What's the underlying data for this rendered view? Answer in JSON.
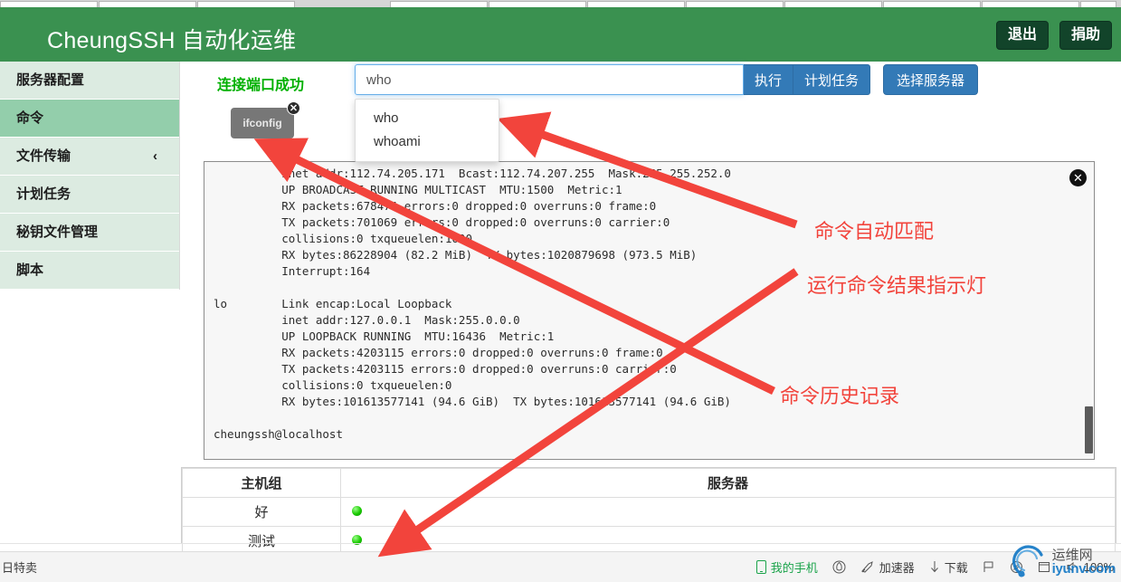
{
  "browser": {
    "tabs_visible": 12
  },
  "header": {
    "brand": "CheungSSH 自动化运维",
    "logout_label": "退出",
    "donate_label": "捐助",
    "bg_color": "#3a9150"
  },
  "sidebar": {
    "items": [
      {
        "label": "服务器配置",
        "active": false,
        "chevron": ""
      },
      {
        "label": "命令",
        "active": true,
        "chevron": ""
      },
      {
        "label": "文件传输",
        "active": false,
        "chevron": "‹"
      },
      {
        "label": "计划任务",
        "active": false,
        "chevron": ""
      },
      {
        "label": "秘钥文件管理",
        "active": false,
        "chevron": ""
      },
      {
        "label": "脚本",
        "active": false,
        "chevron": ""
      }
    ]
  },
  "toolbar": {
    "connection_status": "连接端口成功",
    "connection_status_color": "#00b000",
    "command_value": "who",
    "command_placeholder": "",
    "execute_label": "执行",
    "schedule_label": "计划任务",
    "select_server_label": "选择服务器"
  },
  "autocomplete": {
    "items": [
      "who",
      "whoami"
    ]
  },
  "history": {
    "tags": [
      {
        "label": "ifconfig",
        "close": "✕"
      }
    ]
  },
  "terminal": {
    "close_icon": "✕",
    "output": "          inet addr:112.74.205.171  Bcast:112.74.207.255  Mask:255.255.252.0\n          UP BROADCAST RUNNING MULTICAST  MTU:1500  Metric:1\n          RX packets:678474 errors:0 dropped:0 overruns:0 frame:0\n          TX packets:701069 errors:0 dropped:0 overruns:0 carrier:0\n          collisions:0 txqueuelen:1000\n          RX bytes:86228904 (82.2 MiB)  TX bytes:1020879698 (973.5 MiB)\n          Interrupt:164\n\nlo        Link encap:Local Loopback\n          inet addr:127.0.0.1  Mask:255.0.0.0\n          UP LOOPBACK RUNNING  MTU:16436  Metric:1\n          RX packets:4203115 errors:0 dropped:0 overruns:0 frame:0\n          TX packets:4203115 errors:0 dropped:0 overruns:0 carrier:0\n          collisions:0 txqueuelen:0\n          RX bytes:101613577141 (94.6 GiB)  TX bytes:101613577141 (94.6 GiB)\n\ncheungssh@localhost"
  },
  "annotations": {
    "color": "#f2443c",
    "items": [
      {
        "text": "命令自动匹配"
      },
      {
        "text": "运行命令结果指示灯"
      },
      {
        "text": "命令历史记录"
      }
    ]
  },
  "table": {
    "headers": [
      "主机组",
      "服务器"
    ],
    "rows": [
      {
        "group": "好",
        "status": "online"
      },
      {
        "group": "测试",
        "status": "online"
      }
    ]
  },
  "bottombar": {
    "left_label": "日特卖",
    "items": [
      {
        "icon": "phone-icon",
        "label": "我的手机",
        "accent": true
      },
      {
        "icon": "shield-icon",
        "label": ""
      },
      {
        "icon": "rocket-icon",
        "label": "加速器"
      },
      {
        "icon": "download-icon",
        "label": "下载"
      },
      {
        "icon": "flag-icon",
        "label": ""
      },
      {
        "icon": "compass-icon",
        "label": ""
      },
      {
        "icon": "window-icon",
        "label": ""
      },
      {
        "icon": "mute-icon",
        "label": "100%"
      }
    ]
  },
  "watermark": {
    "cn": "运维网",
    "en": "iyunv.com",
    "color": "#1479c6"
  }
}
